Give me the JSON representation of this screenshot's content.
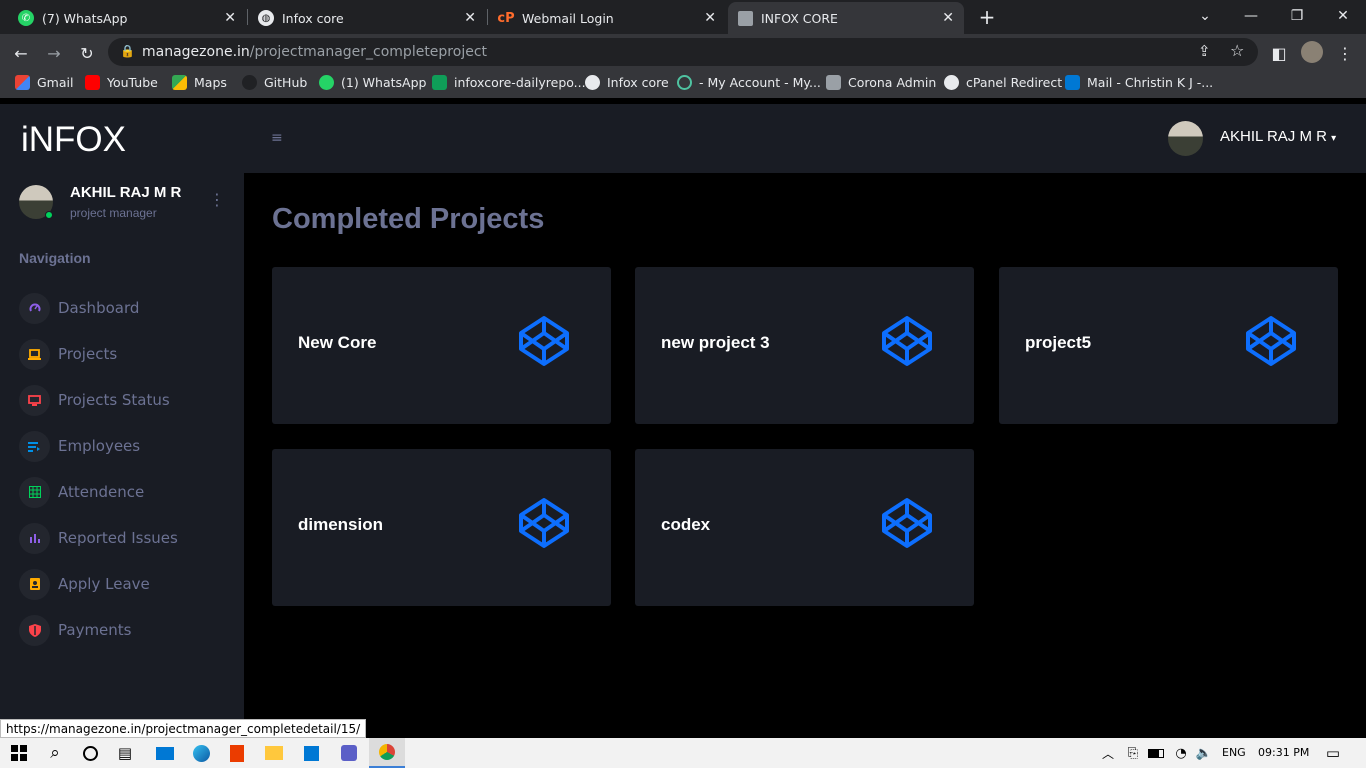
{
  "browser": {
    "tabs": [
      {
        "title": "(7) WhatsApp",
        "icon": "whatsapp-icon"
      },
      {
        "title": "Infox core",
        "icon": "globe-icon"
      },
      {
        "title": "Webmail Login",
        "icon": "cpanel-icon"
      },
      {
        "title": "INFOX CORE",
        "icon": "page-icon"
      }
    ],
    "url_domain": "managezone.in",
    "url_path": "/projectmanager_completeproject",
    "bookmarks": [
      {
        "label": "Gmail",
        "icon": "gmail-icon"
      },
      {
        "label": "YouTube",
        "icon": "youtube-icon"
      },
      {
        "label": "Maps",
        "icon": "maps-icon"
      },
      {
        "label": "GitHub",
        "icon": "github-icon"
      },
      {
        "label": "(1) WhatsApp",
        "icon": "whatsapp-icon"
      },
      {
        "label": "infoxcore-dailyrepo...",
        "icon": "sheets-icon"
      },
      {
        "label": "Infox core",
        "icon": "globe-icon"
      },
      {
        "label": "- My Account - My...",
        "icon": "account-icon"
      },
      {
        "label": "Corona Admin",
        "icon": "page-icon"
      },
      {
        "label": "cPanel Redirect",
        "icon": "globe-icon"
      },
      {
        "label": "Mail - Christin K J -...",
        "icon": "outlook-icon"
      }
    ]
  },
  "app": {
    "logo": "iNFOX",
    "user_name": "AKHIL RAJ M R",
    "user_role": "project manager",
    "nav_heading": "Navigation",
    "nav_items": [
      {
        "label": "Dashboard",
        "icon": "speedometer-icon",
        "color": "#8f5fe8"
      },
      {
        "label": "Projects",
        "icon": "laptop-icon",
        "color": "#ffab00"
      },
      {
        "label": "Projects Status",
        "icon": "monitor-icon",
        "color": "#fc424a"
      },
      {
        "label": "Employees",
        "icon": "list-icon",
        "color": "#0090e7"
      },
      {
        "label": "Attendence",
        "icon": "table-icon",
        "color": "#00d25b"
      },
      {
        "label": "Reported Issues",
        "icon": "chart-icon",
        "color": "#8f5fe8"
      },
      {
        "label": "Apply Leave",
        "icon": "contact-icon",
        "color": "#ffab00"
      },
      {
        "label": "Payments",
        "icon": "shield-icon",
        "color": "#fc424a"
      }
    ],
    "header_user": "AKHIL RAJ M R",
    "page_title": "Completed Projects",
    "projects": [
      {
        "name": "New Core"
      },
      {
        "name": "new project 3"
      },
      {
        "name": "project5"
      },
      {
        "name": "dimension"
      },
      {
        "name": "codex"
      }
    ],
    "accent_color": "#0d6efd"
  },
  "status_url": "https://managezone.in/projectmanager_completedetail/15/",
  "taskbar": {
    "language": "ENG",
    "time": "09:31 PM"
  }
}
